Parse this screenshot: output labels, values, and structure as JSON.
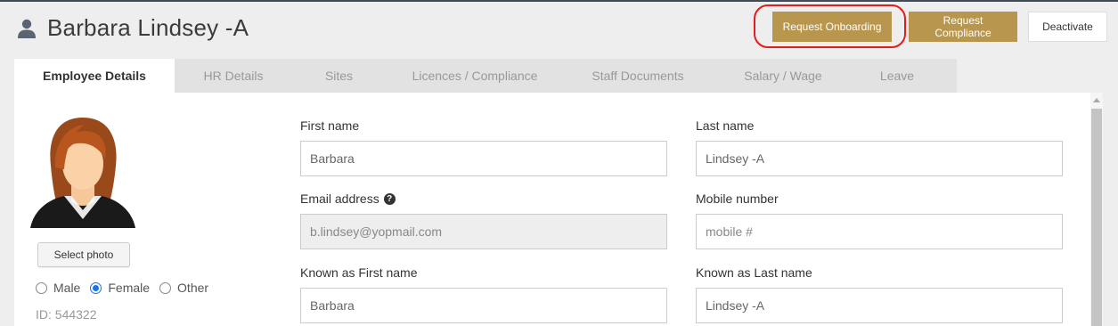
{
  "header": {
    "title": "Barbara Lindsey -A",
    "buttons": {
      "request_onboarding": "Request Onboarding",
      "request_compliance": "Request Compliance",
      "deactivate": "Deactivate"
    }
  },
  "tabs": [
    {
      "label": "Employee Details",
      "active": true
    },
    {
      "label": "HR Details"
    },
    {
      "label": "Sites"
    },
    {
      "label": "Licences / Compliance"
    },
    {
      "label": "Staff Documents"
    },
    {
      "label": "Salary / Wage"
    },
    {
      "label": "Leave"
    }
  ],
  "profile": {
    "select_photo": "Select photo",
    "gender": {
      "options": [
        "Male",
        "Female",
        "Other"
      ],
      "selected": "Female"
    },
    "id_text": "ID: 544322"
  },
  "form": {
    "first_name": {
      "label": "First name",
      "value": "Barbara"
    },
    "last_name": {
      "label": "Last name",
      "value": "Lindsey -A"
    },
    "email": {
      "label": "Email address",
      "value": "b.lindsey@yopmail.com"
    },
    "mobile": {
      "label": "Mobile number",
      "placeholder": "mobile #",
      "value": ""
    },
    "known_first": {
      "label": "Known as First name",
      "value": "Barbara"
    },
    "known_last": {
      "label": "Known as Last name",
      "value": "Lindsey -A"
    }
  },
  "colors": {
    "accent_gold": "#b8964e",
    "highlight_red": "#e01e1e",
    "radio_blue": "#1a73e8"
  },
  "icons": [
    "user-icon",
    "question-circle-icon",
    "female-avatar"
  ]
}
